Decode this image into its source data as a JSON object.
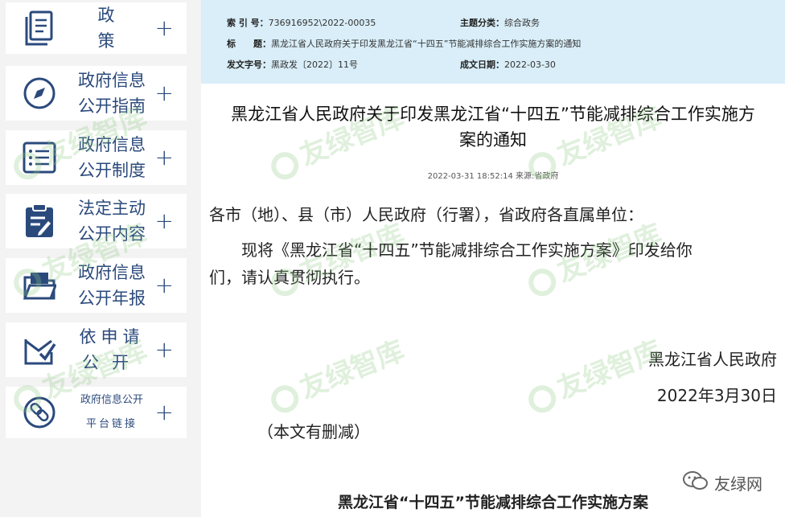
{
  "sidebar": {
    "items": [
      {
        "label": "政　策"
      },
      {
        "label1": "政府信息",
        "label2": "公开指南"
      },
      {
        "label1": "政府信息",
        "label2": "公开制度"
      },
      {
        "label1": "法定主动",
        "label2": "公开内容"
      },
      {
        "label1": "政府信息",
        "label2": "公开年报"
      },
      {
        "label1": "依申请",
        "label2": "公开"
      },
      {
        "label1": "政府信息公开",
        "label2": "平台链接"
      }
    ],
    "plus": "+"
  },
  "meta": {
    "index_label": "索 引 号：",
    "index_value": "736916952\\2022-00035",
    "category_label": "主题分类：",
    "category_value": "综合政务",
    "title_label": "标　　题：",
    "title_value": "黑龙江省人民政府关于印发黑龙江省“十四五”节能减排综合工作实施方案的通知",
    "docno_label": "发文字号：",
    "docno_value": "黑政发〔2022〕11号",
    "date_label": "成文日期：",
    "date_value": "2022-03-30"
  },
  "article": {
    "title_line1": "黑龙江省人民政府关于印发黑龙江省“十四五”节能减排综合工作实施方",
    "title_line2": "案的通知",
    "dateline": "2022-03-31 18:52:14 来源:省政府",
    "salutation": "各市（地）、县（市）人民政府（行署），省政府各直属单位：",
    "para1_line1": "　　现将《黑龙江省“十四五”节能减排综合工作实施方案》印发给你",
    "para1_line2": "们，请认真贯彻执行。",
    "signature": "黑龙江省人民政府",
    "sign_date": "2022年3月30日",
    "note": "（本文有删减）",
    "subtitle": "黑龙江省“十四五”节能减排综合工作实施方案"
  },
  "watermark": "友绿智库",
  "badge": "友绿网",
  "colors": {
    "accent": "#2b4a7c",
    "meta_bg": "#d9eef8"
  }
}
